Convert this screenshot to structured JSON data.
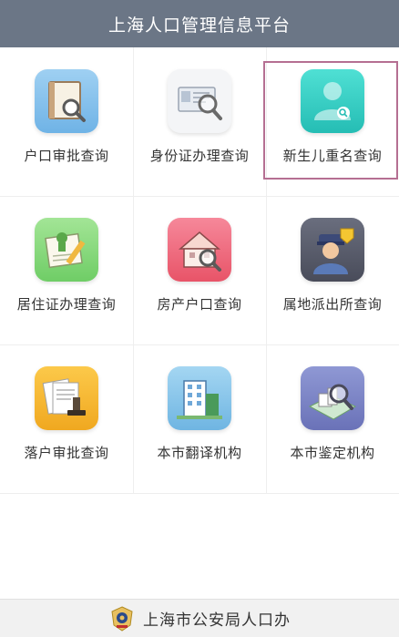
{
  "header": {
    "title": "上海人口管理信息平台"
  },
  "items": [
    {
      "label": "户口审批查询",
      "icon": "book-magnifier-icon",
      "color": "#8fc6ec"
    },
    {
      "label": "身份证办理查询",
      "icon": "id-card-magnifier-icon",
      "color": "#f4f5f7"
    },
    {
      "label": "新生儿重名查询",
      "icon": "person-search-icon",
      "color": "#33d0c6"
    },
    {
      "label": "居住证办理查询",
      "icon": "certificate-pencil-icon",
      "color": "#8fdb84"
    },
    {
      "label": "房产户口查询",
      "icon": "house-magnifier-icon",
      "color": "#f06b7f"
    },
    {
      "label": "属地派出所查询",
      "icon": "police-officer-icon",
      "color": "#575a6a"
    },
    {
      "label": "落户审批查询",
      "icon": "documents-stamp-icon",
      "color": "#f6b933"
    },
    {
      "label": "本市翻译机构",
      "icon": "building-icon",
      "color": "#8cc8ec"
    },
    {
      "label": "本市鉴定机构",
      "icon": "map-magnifier-icon",
      "color": "#7d86c6"
    }
  ],
  "selected_item": "新生儿重名查询",
  "footer": {
    "text": "上海市公安局人口办",
    "icon": "police-emblem-icon"
  }
}
